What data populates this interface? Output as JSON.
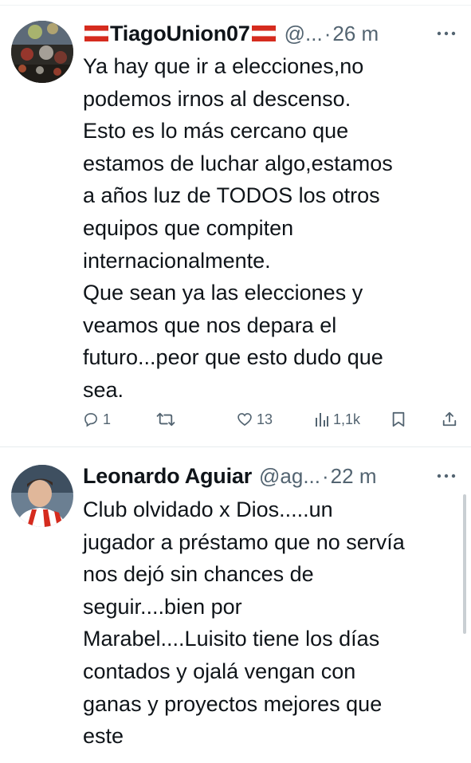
{
  "tweets": [
    {
      "display_name": "TiagoUnion07",
      "handle": "@...",
      "separator": "·",
      "time": "26 m",
      "text": "Ya hay que ir a elecciones,no\npodemos irnos al descenso.\nEsto es lo más cercano que\nestamos de luchar algo,estamos\na años luz de TODOS los otros\nequipos que compiten\ninternacionalmente.\nQue sean ya las elecciones y\nveamos que nos depara el\nfuturo...peor que esto dudo que\nsea.",
      "actions": {
        "reply_icon": "reply-icon",
        "reply_count": "1",
        "retweet_icon": "retweet-icon",
        "like_icon": "heart-icon",
        "like_count": "13",
        "views_icon": "views-chart-icon",
        "views_count": "1,1k",
        "bookmark_icon": "bookmark-icon",
        "share_icon": "share-icon"
      }
    },
    {
      "display_name": "Leonardo Aguiar",
      "handle": "@ag...",
      "separator": "·",
      "time": "22 m",
      "text": "Club olvidado x Dios.....un\njugador a préstamo que no servía\nnos dejó sin chances de\nseguir....bien por\nMarabel....Luisito tiene los días\ncontados y ojalá vengan con\nganas y proyectos mejores que\neste"
    }
  ],
  "colors": {
    "text": "#0f1419",
    "secondary": "#536471",
    "divider": "#e6ebee",
    "flag_red": "#d52b1e"
  }
}
